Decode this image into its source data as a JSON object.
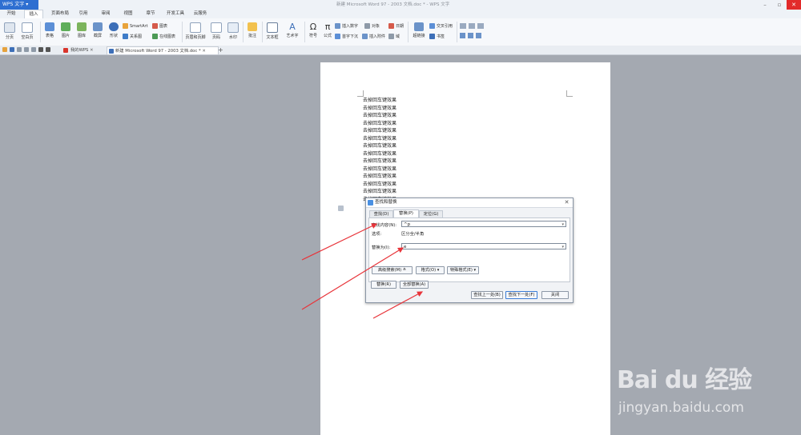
{
  "app": {
    "menu_label": "WPS 文字",
    "window_title": "新建 Microsoft Word 97 - 2003 文档.doc * - WPS 文字"
  },
  "ribbon_tabs": [
    "开始",
    "插入",
    "页面布局",
    "引用",
    "审阅",
    "视图",
    "章节",
    "开发工具",
    "云服务"
  ],
  "active_tab": "插入",
  "ribbon": {
    "page_break": "分页",
    "blank_page": "空白页",
    "table": "表格",
    "picture": "图片",
    "gallery": "图库",
    "screenshot": "截屏",
    "shape": "形状",
    "smartart": "SmartArt",
    "relation_chart": "关系图",
    "chart": "图表",
    "online_chart": "在线图表",
    "header_footer": "页眉和页脚",
    "page_number": "页码",
    "watermark": "水印",
    "comment": "批注",
    "textbox": "文本框",
    "wordart": "艺术字",
    "symbol": "符号",
    "formula": "公式",
    "insert_number": "插入数字",
    "object": "对象",
    "date": "日期",
    "first_letter": "首字下沉",
    "attachment": "插入附件",
    "field": "域",
    "hyperlink": "超链接",
    "bookmark": "书签",
    "cross_reference": "交叉引用"
  },
  "doc_tabs": {
    "my_wps": "我的WPS",
    "active_doc": "新建 Microsoft Word 97 - 2003 文档.doc *",
    "new_tab": "+"
  },
  "document": {
    "lines": [
      "去掉回车键效果",
      "去掉回车键效果",
      "去掉回车键效果",
      "去掉回车键效果",
      "去掉回车键效果",
      "去掉回车键效果",
      "去掉回车键效果",
      "去掉回车键效果",
      "去掉回车键效果",
      "去掉回车键效果",
      "去掉回车键效果",
      "去掉回车键效果",
      "去掉回车键效果",
      "去掉回车键效果"
    ]
  },
  "dialog": {
    "title": "查找和替换",
    "tabs": [
      "查找(D)",
      "替换(P)",
      "定位(G)"
    ],
    "active_tab": "替换(P)",
    "find_label": "查找内容(N):",
    "find_value": "^p",
    "options_label": "选项:",
    "options_value": "区分全/半角",
    "replace_label": "替换为(I):",
    "replace_value": "e",
    "advanced_button": "高级搜索(M) ≛",
    "format_button": "格式(O) ▾",
    "special_button": "特殊格式(E) ▾",
    "replace_button": "替换(R)",
    "replace_all_button": "全部替换(A)",
    "find_prev_button": "查找上一处(B)",
    "find_next_button": "查找下一处(F)",
    "close_button": "关闭"
  },
  "annotations": {
    "arrow_color": "#e8343a"
  },
  "watermark": {
    "logo": "Bai du 经验",
    "url": "jingyan.baidu.com"
  }
}
